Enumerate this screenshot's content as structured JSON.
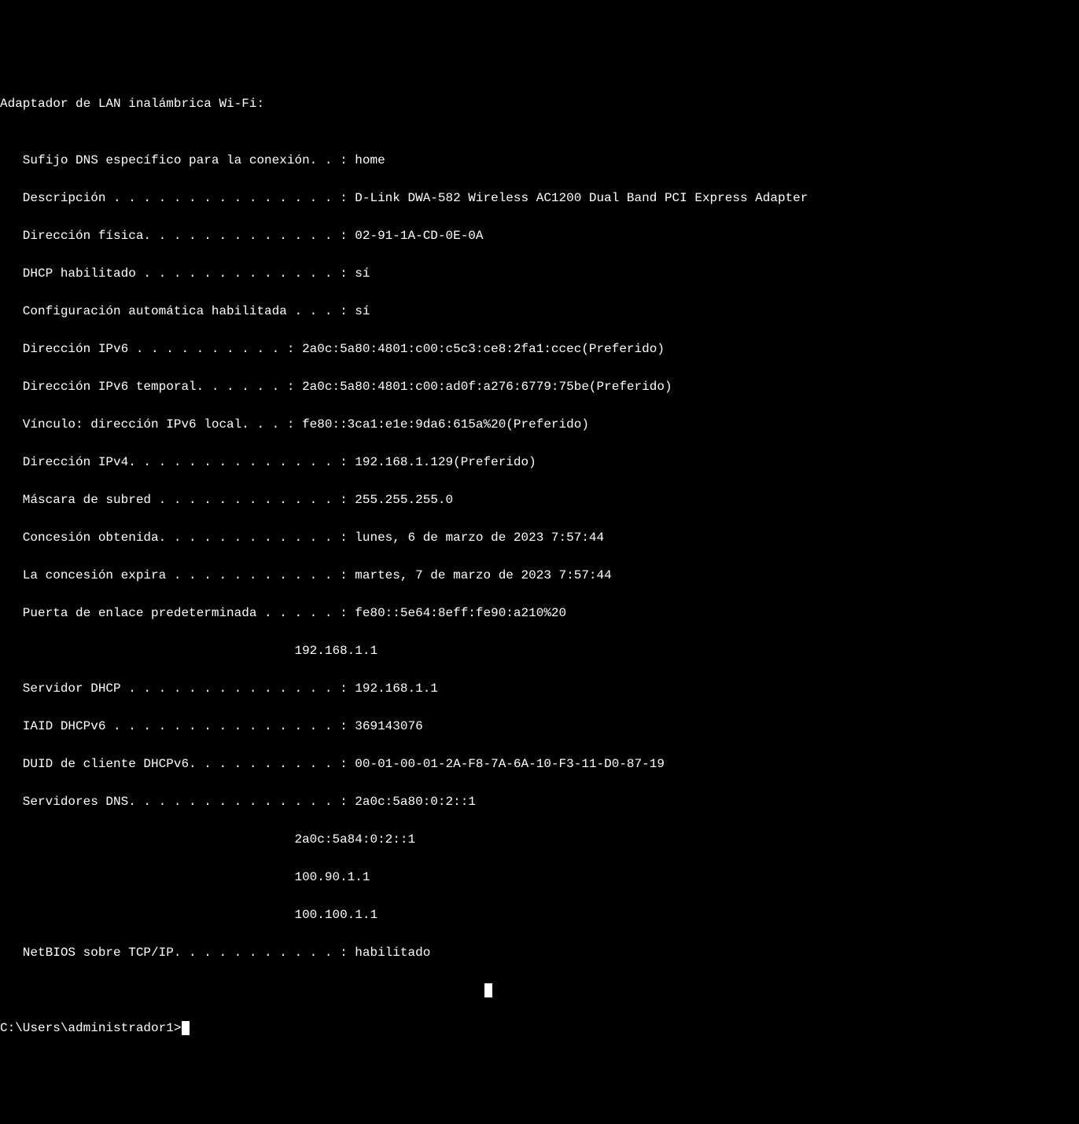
{
  "header": "Adaptador de LAN inalámbrica Wi-Fi:",
  "blank": "",
  "entries": {
    "dns_suffix": "   Sufijo DNS específico para la conexión. . : home",
    "description": "   Descripción . . . . . . . . . . . . . . . : D-Link DWA-582 Wireless AC1200 Dual Band PCI Express Adapter",
    "physical_addr": "   Dirección física. . . . . . . . . . . . . : 02-91-1A-CD-0E-0A",
    "dhcp_enabled": "   DHCP habilitado . . . . . . . . . . . . . : sí",
    "autoconfig": "   Configuración automática habilitada . . . : sí",
    "ipv6_addr": "   Dirección IPv6 . . . . . . . . . . : 2a0c:5a80:4801:c00:c5c3:ce8:2fa1:ccec(Preferido)",
    "ipv6_temp": "   Dirección IPv6 temporal. . . . . . : 2a0c:5a80:4801:c00:ad0f:a276:6779:75be(Preferido)",
    "ipv6_link": "   Vínculo: dirección IPv6 local. . . : fe80::3ca1:e1e:9da6:615a%20(Preferido)",
    "ipv4_addr": "   Dirección IPv4. . . . . . . . . . . . . . : 192.168.1.129(Preferido)",
    "subnet_mask": "   Máscara de subred . . . . . . . . . . . . : 255.255.255.0",
    "lease_obtained": "   Concesión obtenida. . . . . . . . . . . . : lunes, 6 de marzo de 2023 7:57:44",
    "lease_expires": "   La concesión expira . . . . . . . . . . . : martes, 7 de marzo de 2023 7:57:44",
    "gateway1": "   Puerta de enlace predeterminada . . . . . : fe80::5e64:8eff:fe90:a210%20",
    "gateway2": "                                       192.168.1.1",
    "dhcp_server": "   Servidor DHCP . . . . . . . . . . . . . . : 192.168.1.1",
    "iaid": "   IAID DHCPv6 . . . . . . . . . . . . . . . : 369143076",
    "duid": "   DUID de cliente DHCPv6. . . . . . . . . . : 00-01-00-01-2A-F8-7A-6A-10-F3-11-D0-87-19",
    "dns1": "   Servidores DNS. . . . . . . . . . . . . . : 2a0c:5a80:0:2::1",
    "dns2": "                                       2a0c:5a84:0:2::1",
    "dns3": "                                       100.90.1.1",
    "dns4": "                                       100.100.1.1",
    "netbios": "   NetBIOS sobre TCP/IP. . . . . . . . . . . : habilitado"
  },
  "prompt": "C:\\Users\\administrador1>"
}
